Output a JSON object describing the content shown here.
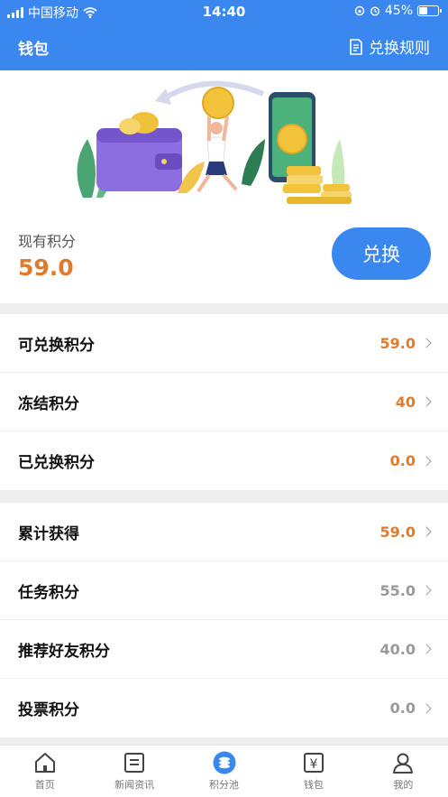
{
  "status_bar": {
    "carrier": "中国移动",
    "time": "14:40",
    "battery": "45%",
    "battery_level": 0.45
  },
  "nav": {
    "title": "钱包",
    "rules_label": "兑换规则"
  },
  "summary": {
    "current_label": "现有积分",
    "current_value": "59.0",
    "exchange_label": "兑换"
  },
  "group1": [
    {
      "label": "可兑换积分",
      "value": "59.0"
    },
    {
      "label": "冻结积分",
      "value": "40"
    },
    {
      "label": "已兑换积分",
      "value": "0.0"
    }
  ],
  "group2": [
    {
      "label": "累计获得",
      "value": "59.0"
    },
    {
      "label": "任务积分",
      "value": "55.0"
    },
    {
      "label": "推荐好友积分",
      "value": "40.0"
    },
    {
      "label": "投票积分",
      "value": "0.0"
    }
  ],
  "tabs": [
    {
      "label": "首页",
      "icon": "home-icon"
    },
    {
      "label": "新闻资讯",
      "icon": "news-icon"
    },
    {
      "label": "积分池",
      "icon": "points-pool-icon"
    },
    {
      "label": "钱包",
      "icon": "wallet-icon"
    },
    {
      "label": "我的",
      "icon": "profile-icon"
    }
  ],
  "colors": {
    "primary": "#3a87f0",
    "accent_orange": "#e07b2e",
    "muted_gray": "#9a9a9a"
  }
}
